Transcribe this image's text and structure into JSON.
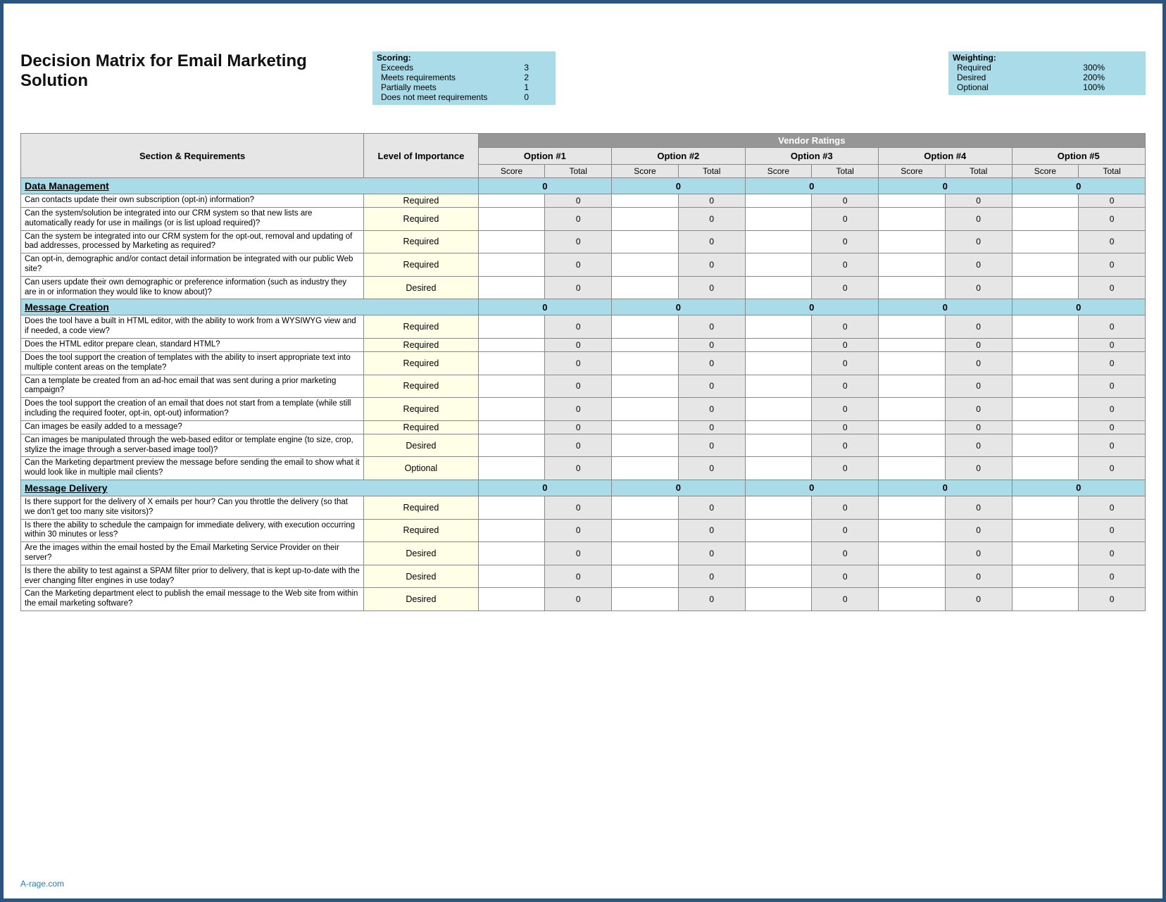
{
  "title": "Decision Matrix for Email Marketing Solution",
  "scoring": {
    "label": "Scoring:",
    "items": [
      {
        "text": "Exceeds",
        "value": "3"
      },
      {
        "text": "Meets requirements",
        "value": "2"
      },
      {
        "text": "Partially meets",
        "value": "1"
      },
      {
        "text": "Does not meet requirements",
        "value": "0"
      }
    ]
  },
  "weighting": {
    "label": "Weighting:",
    "items": [
      {
        "text": "Required",
        "value": "300%"
      },
      {
        "text": "Desired",
        "value": "200%"
      },
      {
        "text": "Optional",
        "value": "100%"
      }
    ]
  },
  "headers": {
    "vendor_ratings": "Vendor Ratings",
    "section_req": "Section & Requirements",
    "level": "Level of Importance",
    "options": [
      "Option #1",
      "Option #2",
      "Option #3",
      "Option #4",
      "Option #5"
    ],
    "score": "Score",
    "total": "Total"
  },
  "sections": [
    {
      "name": "Data Management",
      "totals": [
        "0",
        "0",
        "0",
        "0",
        "0"
      ],
      "rows": [
        {
          "req": "Can contacts update their own subscription (opt-in) information?",
          "imp": "Required",
          "scores": [
            "",
            "",
            "",
            "",
            ""
          ],
          "totals": [
            "0",
            "0",
            "0",
            "0",
            "0"
          ]
        },
        {
          "req": "Can the system/solution be integrated into our CRM system so that new lists are automatically ready for use in mailings (or is list upload required)?",
          "imp": "Required",
          "scores": [
            "",
            "",
            "",
            "",
            ""
          ],
          "totals": [
            "0",
            "0",
            "0",
            "0",
            "0"
          ]
        },
        {
          "req": "Can the system be integrated into our CRM system for the opt-out, removal and updating of bad addresses, processed by Marketing as required?",
          "imp": "Required",
          "scores": [
            "",
            "",
            "",
            "",
            ""
          ],
          "totals": [
            "0",
            "0",
            "0",
            "0",
            "0"
          ]
        },
        {
          "req": "Can opt-in, demographic and/or contact detail information be integrated with our public Web site?",
          "imp": "Required",
          "scores": [
            "",
            "",
            "",
            "",
            ""
          ],
          "totals": [
            "0",
            "0",
            "0",
            "0",
            "0"
          ]
        },
        {
          "req": "Can users update their own demographic or preference information (such as industry they are in or information they would like to know about)?",
          "imp": "Desired",
          "scores": [
            "",
            "",
            "",
            "",
            ""
          ],
          "totals": [
            "0",
            "0",
            "0",
            "0",
            "0"
          ]
        }
      ]
    },
    {
      "name": "Message Creation",
      "totals": [
        "0",
        "0",
        "0",
        "0",
        "0"
      ],
      "rows": [
        {
          "req": "Does the tool have a built in HTML editor, with the ability to work from a WYSIWYG view and if needed, a code view?",
          "imp": "Required",
          "scores": [
            "",
            "",
            "",
            "",
            ""
          ],
          "totals": [
            "0",
            "0",
            "0",
            "0",
            "0"
          ]
        },
        {
          "req": "Does the HTML editor prepare clean, standard HTML?",
          "imp": "Required",
          "scores": [
            "",
            "",
            "",
            "",
            ""
          ],
          "totals": [
            "0",
            "0",
            "0",
            "0",
            "0"
          ]
        },
        {
          "req": "Does the tool support the creation of templates with the ability to insert appropriate text into multiple content areas on the template?",
          "imp": "Required",
          "scores": [
            "",
            "",
            "",
            "",
            ""
          ],
          "totals": [
            "0",
            "0",
            "0",
            "0",
            "0"
          ]
        },
        {
          "req": "Can a template be created from an ad-hoc email that was sent during a prior marketing campaign?",
          "imp": "Required",
          "scores": [
            "",
            "",
            "",
            "",
            ""
          ],
          "totals": [
            "0",
            "0",
            "0",
            "0",
            "0"
          ]
        },
        {
          "req": "Does the tool support the creation of an email that does not start from a template (while still including the required footer, opt-in, opt-out) information?",
          "imp": "Required",
          "scores": [
            "",
            "",
            "",
            "",
            ""
          ],
          "totals": [
            "0",
            "0",
            "0",
            "0",
            "0"
          ]
        },
        {
          "req": "Can images be easily added to a message?",
          "imp": "Required",
          "scores": [
            "",
            "",
            "",
            "",
            ""
          ],
          "totals": [
            "0",
            "0",
            "0",
            "0",
            "0"
          ]
        },
        {
          "req": "Can images be manipulated through the web-based editor or template engine (to size, crop, stylize the image through a server-based image tool)?",
          "imp": "Desired",
          "scores": [
            "",
            "",
            "",
            "",
            ""
          ],
          "totals": [
            "0",
            "0",
            "0",
            "0",
            "0"
          ]
        },
        {
          "req": "Can the Marketing department preview the message before sending the email to show what it would look like in multiple mail clients?",
          "imp": "Optional",
          "scores": [
            "",
            "",
            "",
            "",
            ""
          ],
          "totals": [
            "0",
            "0",
            "0",
            "0",
            "0"
          ]
        }
      ]
    },
    {
      "name": "Message Delivery",
      "totals": [
        "0",
        "0",
        "0",
        "0",
        "0"
      ],
      "rows": [
        {
          "req": "Is there support for the delivery of X emails per hour?  Can you throttle the delivery (so that we don't get too many site visitors)?",
          "imp": "Required",
          "scores": [
            "",
            "",
            "",
            "",
            ""
          ],
          "totals": [
            "0",
            "0",
            "0",
            "0",
            "0"
          ]
        },
        {
          "req": "Is there the ability to schedule the campaign for immediate delivery, with execution occurring within 30 minutes or less?",
          "imp": "Required",
          "scores": [
            "",
            "",
            "",
            "",
            ""
          ],
          "totals": [
            "0",
            "0",
            "0",
            "0",
            "0"
          ]
        },
        {
          "req": "Are the images within the email hosted by the Email Marketing Service Provider on their server?",
          "imp": "Desired",
          "scores": [
            "",
            "",
            "",
            "",
            ""
          ],
          "totals": [
            "0",
            "0",
            "0",
            "0",
            "0"
          ]
        },
        {
          "req": "Is there the ability to test against a SPAM filter prior to delivery, that is kept up-to-date with the ever changing filter engines in use today?",
          "imp": "Desired",
          "scores": [
            "",
            "",
            "",
            "",
            ""
          ],
          "totals": [
            "0",
            "0",
            "0",
            "0",
            "0"
          ]
        },
        {
          "req": "Can the Marketing department elect to publish the email message to the Web site from within the email marketing software?",
          "imp": "Desired",
          "scores": [
            "",
            "",
            "",
            "",
            ""
          ],
          "totals": [
            "0",
            "0",
            "0",
            "0",
            "0"
          ]
        }
      ]
    }
  ],
  "footer": "A-rage.com"
}
